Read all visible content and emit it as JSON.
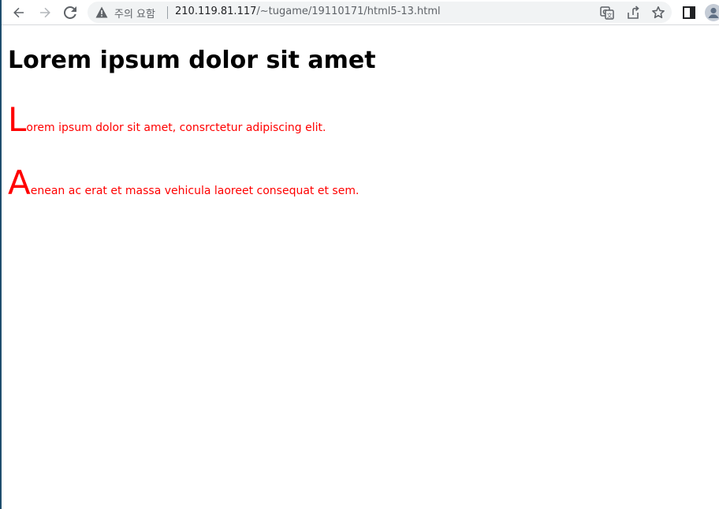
{
  "browser": {
    "security_label": "주의 요함",
    "url_host": "210.119.81.117",
    "url_path": "/~tugame/19110171/html5-13.html"
  },
  "page": {
    "heading": "Lorem ipsum dolor sit amet",
    "paragraphs": [
      {
        "first_letter": "L",
        "rest": "orem ipsum dolor sit amet, consrctetur adipiscing elit."
      },
      {
        "first_letter": "A",
        "rest": "enean ac erat et massa vehicula laoreet consequat et sem."
      }
    ]
  },
  "colors": {
    "paragraph_text": "#ff0000",
    "heading_text": "#000000",
    "omnibox_bg": "#f1f3f4"
  }
}
